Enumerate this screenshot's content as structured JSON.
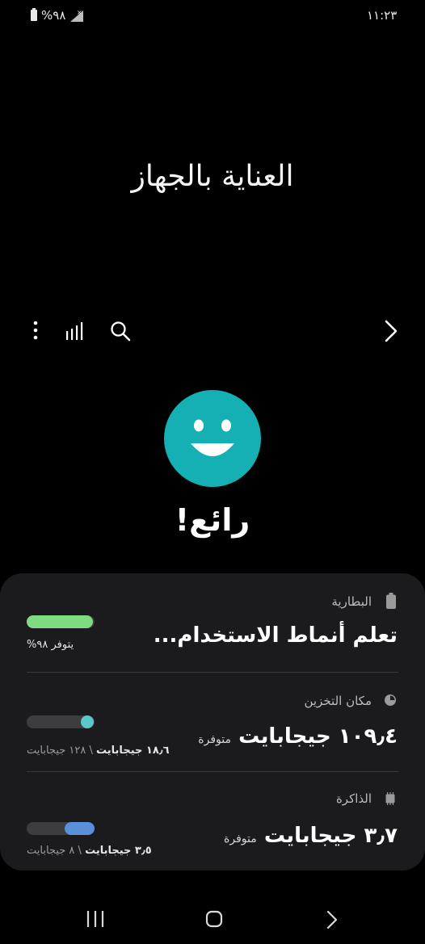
{
  "status_bar": {
    "time": "١١:٢٣",
    "battery_percent": "%٩٨",
    "battery_level": 0.98
  },
  "title": "العناية بالجهاز",
  "toolbar": {
    "icons": [
      "more-options-icon",
      "reports-icon",
      "search-icon",
      "back-icon"
    ]
  },
  "status": {
    "label": "رائع!",
    "color": "#14b0b3"
  },
  "battery": {
    "title": "البطارية",
    "headline": "تعلم أنماط الاستخدام...",
    "available": "يتوفر ٩٨%",
    "level": 0.98,
    "color": "#7fdb7f"
  },
  "storage": {
    "title": "مكان التخزين",
    "value": "١٠٩٫٤ جيجابايت",
    "value_suffix": "متوفرة",
    "used": "١٨٫٦ جيجابايت",
    "separator": "\\",
    "total": "١٢٨ جيجابايت",
    "level": 0.145,
    "color": "#5bc7c9"
  },
  "memory": {
    "title": "الذاكرة",
    "value": "٣٫٧ جيجابايت",
    "value_suffix": "متوفرة",
    "used": "٣٫٥ جيجابايت",
    "separator": "\\",
    "total": "٨ جيجابايت",
    "level": 0.44,
    "color": "#5a8fdc"
  },
  "nav": {
    "icons": [
      "recent-apps-icon",
      "home-icon",
      "back-nav-icon"
    ]
  }
}
